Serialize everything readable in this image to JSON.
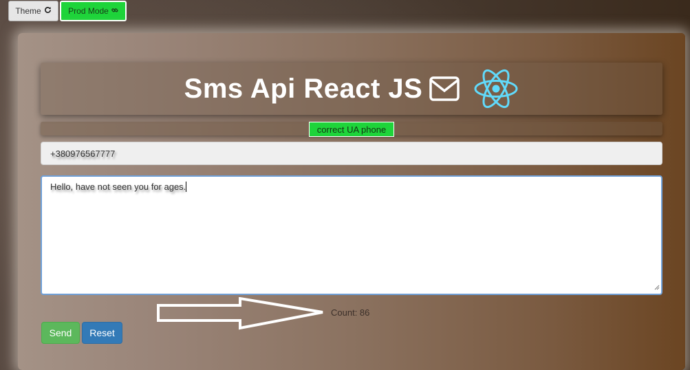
{
  "toolbar": {
    "theme_label": "Theme",
    "theme_icon": "refresh-icon",
    "prod_label": "Prod Mode",
    "prod_icon": "link-icon"
  },
  "header": {
    "title": "Sms Api React JS",
    "icons": [
      "envelope-icon",
      "react-logo-icon"
    ]
  },
  "status": {
    "badge": "correct UA phone",
    "badge_color": "#1ed43a"
  },
  "form": {
    "phone_value": "+380976567777",
    "message_value": "Hello, have not seen you for ages.",
    "count_text": "Count: 86",
    "send_label": "Send",
    "reset_label": "Reset"
  },
  "colors": {
    "send": "#5cb85c",
    "reset": "#337ab7",
    "react": "#61dafb",
    "accent_green": "#1ed43a"
  }
}
